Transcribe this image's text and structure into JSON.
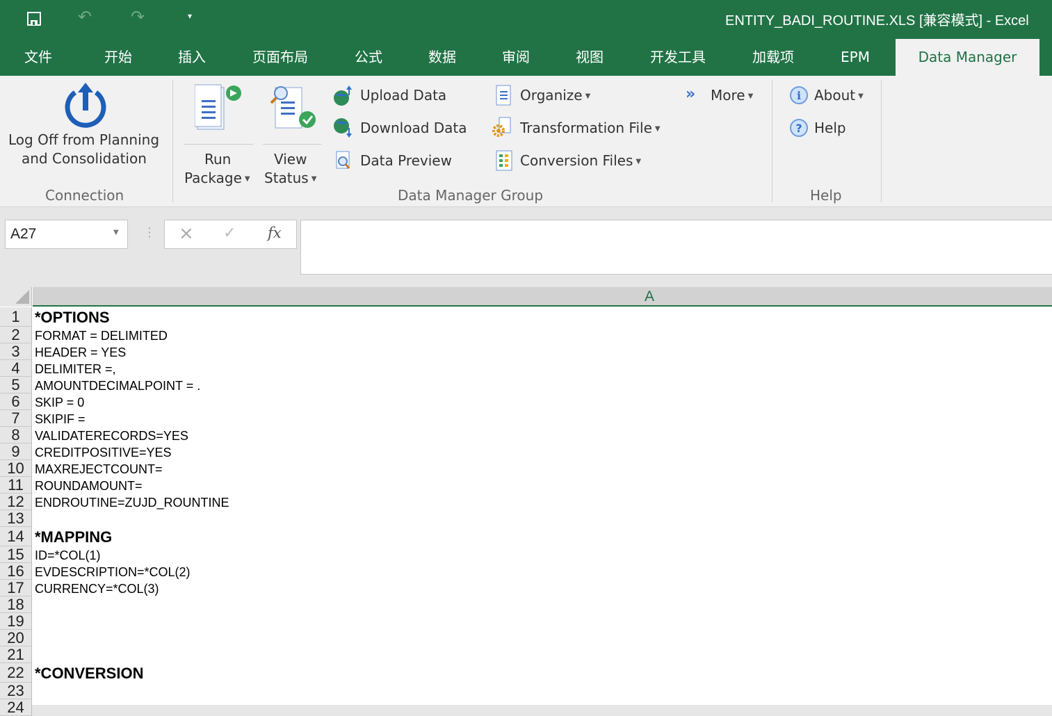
{
  "title": "ENTITY_BADI_ROUTINE.XLS  [兼容模式]  -  Excel",
  "quick_access": {
    "save": "save-icon",
    "undo": "undo-icon",
    "redo": "redo-icon",
    "customize": "customize-icon"
  },
  "tabs": [
    {
      "label": "文件"
    },
    {
      "label": "开始"
    },
    {
      "label": "插入"
    },
    {
      "label": "页面布局"
    },
    {
      "label": "公式"
    },
    {
      "label": "数据"
    },
    {
      "label": "审阅"
    },
    {
      "label": "视图"
    },
    {
      "label": "开发工具"
    },
    {
      "label": "加载项"
    },
    {
      "label": "EPM"
    },
    {
      "label": "Data Manager",
      "active": true
    }
  ],
  "ribbon": {
    "connection": {
      "logoff_line1": "Log Off from Planning",
      "logoff_line2": "and Consolidation",
      "group": "Connection"
    },
    "dm": {
      "run1": "Run",
      "run2": "Package",
      "view1": "View",
      "view2": "Status",
      "upload": "Upload Data",
      "download": "Download Data",
      "preview": "Data Preview",
      "organize": "Organize",
      "transformation": "Transformation File",
      "conversion": "Conversion Files",
      "more": "More",
      "group": "Data Manager Group"
    },
    "help": {
      "about": "About",
      "help": "Help",
      "group": "Help"
    }
  },
  "formula_bar": {
    "name_box": "A27",
    "cancel": "×",
    "enter": "✓",
    "fx": "fx",
    "value": ""
  },
  "columns": [
    "A"
  ],
  "accent": "#217346",
  "rows": [
    {
      "n": "1",
      "text": "*OPTIONS",
      "bold": true
    },
    {
      "n": "2",
      "text": "FORMAT = DELIMITED"
    },
    {
      "n": "3",
      "text": "HEADER = YES"
    },
    {
      "n": "4",
      "text": "DELIMITER =,"
    },
    {
      "n": "5",
      "text": "AMOUNTDECIMALPOINT = ."
    },
    {
      "n": "6",
      "text": "SKIP = 0"
    },
    {
      "n": "7",
      "text": "SKIPIF ="
    },
    {
      "n": "8",
      "text": "VALIDATERECORDS=YES"
    },
    {
      "n": "9",
      "text": "CREDITPOSITIVE=YES"
    },
    {
      "n": "10",
      "text": "MAXREJECTCOUNT="
    },
    {
      "n": "11",
      "text": "ROUNDAMOUNT="
    },
    {
      "n": "12",
      "text": "ENDROUTINE=ZUJD_ROUNTINE"
    },
    {
      "n": "13",
      "text": ""
    },
    {
      "n": "14",
      "text": "*MAPPING",
      "bold": true
    },
    {
      "n": "15",
      "text": "ID=*COL(1)"
    },
    {
      "n": "16",
      "text": "EVDESCRIPTION=*COL(2)"
    },
    {
      "n": "17",
      "text": "CURRENCY=*COL(3)"
    },
    {
      "n": "18",
      "text": ""
    },
    {
      "n": "19",
      "text": ""
    },
    {
      "n": "20",
      "text": ""
    },
    {
      "n": "21",
      "text": ""
    },
    {
      "n": "22",
      "text": "*CONVERSION",
      "bold": true
    },
    {
      "n": "23",
      "text": ""
    },
    {
      "n": "24",
      "text": ""
    }
  ]
}
